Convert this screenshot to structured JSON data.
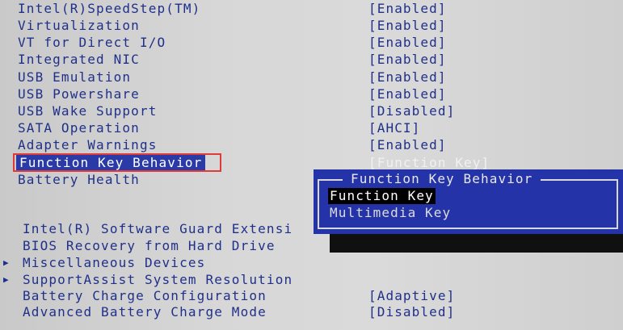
{
  "settings": [
    {
      "label": "Intel(R)SpeedStep(TM)",
      "value": "[Enabled]"
    },
    {
      "label": "Virtualization",
      "value": "[Enabled]"
    },
    {
      "label": "VT for Direct I/O",
      "value": "[Enabled]"
    },
    {
      "label": "Integrated NIC",
      "value": "[Enabled]"
    },
    {
      "label": "USB Emulation",
      "value": "[Enabled]"
    },
    {
      "label": "USB Powershare",
      "value": "[Enabled]"
    },
    {
      "label": "USB Wake Support",
      "value": "[Disabled]"
    },
    {
      "label": "SATA Operation",
      "value": "[AHCI]"
    },
    {
      "label": "Adapter Warnings",
      "value": "[Enabled]"
    },
    {
      "label": "Function Key Behavior",
      "value": "[Function Key]"
    },
    {
      "label": "Battery Health",
      "value": ""
    }
  ],
  "lower_settings": [
    {
      "label": "Intel(R) Software Guard Extensi",
      "value": "",
      "arrow": ""
    },
    {
      "label": "BIOS Recovery from Hard Drive",
      "value": "",
      "arrow": ""
    },
    {
      "label": "Miscellaneous Devices",
      "value": "",
      "arrow": "▶"
    },
    {
      "label": "SupportAssist System Resolution",
      "value": "",
      "arrow": "▶"
    },
    {
      "label": "Battery Charge Configuration",
      "value": "[Adaptive]",
      "arrow": ""
    },
    {
      "label": "Advanced Battery Charge Mode",
      "value": "[Disabled]",
      "arrow": ""
    }
  ],
  "popup": {
    "title": "Function Key Behavior",
    "options": [
      "Function Key",
      "Multimedia Key"
    ],
    "selected_index": 0
  },
  "colors": {
    "popup_background": "#2434a8",
    "highlight_border": "#e03a3a",
    "text": "#20308a"
  }
}
